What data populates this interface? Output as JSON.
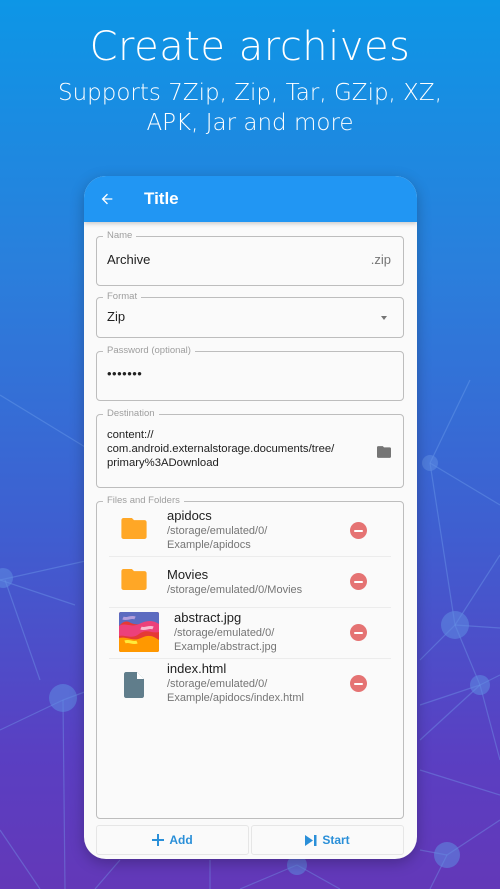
{
  "headline": {
    "title": "Create archives",
    "subtitle_line1": "Supports 7Zip, Zip, Tar, GZip, XZ,",
    "subtitle_line2": "APK, Jar and more"
  },
  "appbar": {
    "back_icon": "arrow-back-icon",
    "title": "Title"
  },
  "form": {
    "name": {
      "label": "Name",
      "value": "Archive",
      "suffix": ".zip"
    },
    "format": {
      "label": "Format",
      "value": "Zip",
      "icon": "dropdown-arrow-icon"
    },
    "password": {
      "label": "Password (optional)",
      "value": "•••••••"
    },
    "destination": {
      "label": "Destination",
      "value": "content://\ncom.android.externalstorage.documents/tree/\nprimary%3ADownload",
      "icon": "folder-icon"
    },
    "files": {
      "label": "Files and Folders",
      "items": [
        {
          "name": "apidocs",
          "path": "/storage/emulated/0/\nExample/apidocs",
          "type": "folder",
          "icon": "folder-icon",
          "remove_icon": "remove-circle-icon"
        },
        {
          "name": "Movies",
          "path": "/storage/emulated/0/Movies",
          "type": "folder",
          "icon": "folder-icon",
          "remove_icon": "remove-circle-icon"
        },
        {
          "name": "abstract.jpg",
          "path": "/storage/emulated/0/\nExample/abstract.jpg",
          "type": "image",
          "icon": "image-thumbnail",
          "remove_icon": "remove-circle-icon"
        },
        {
          "name": "index.html",
          "path": "/storage/emulated/0/\nExample/apidocs/index.html",
          "type": "file",
          "icon": "file-icon",
          "remove_icon": "remove-circle-icon"
        }
      ]
    }
  },
  "actions": {
    "add": {
      "label": "Add",
      "icon": "plus-icon"
    },
    "start": {
      "label": "Start",
      "icon": "skip-next-icon"
    }
  },
  "colors": {
    "primary": "#2196f3",
    "folder": "#ffa726",
    "file": "#607d8b",
    "remove": "#e57373",
    "button_text": "#2a8fd8"
  }
}
